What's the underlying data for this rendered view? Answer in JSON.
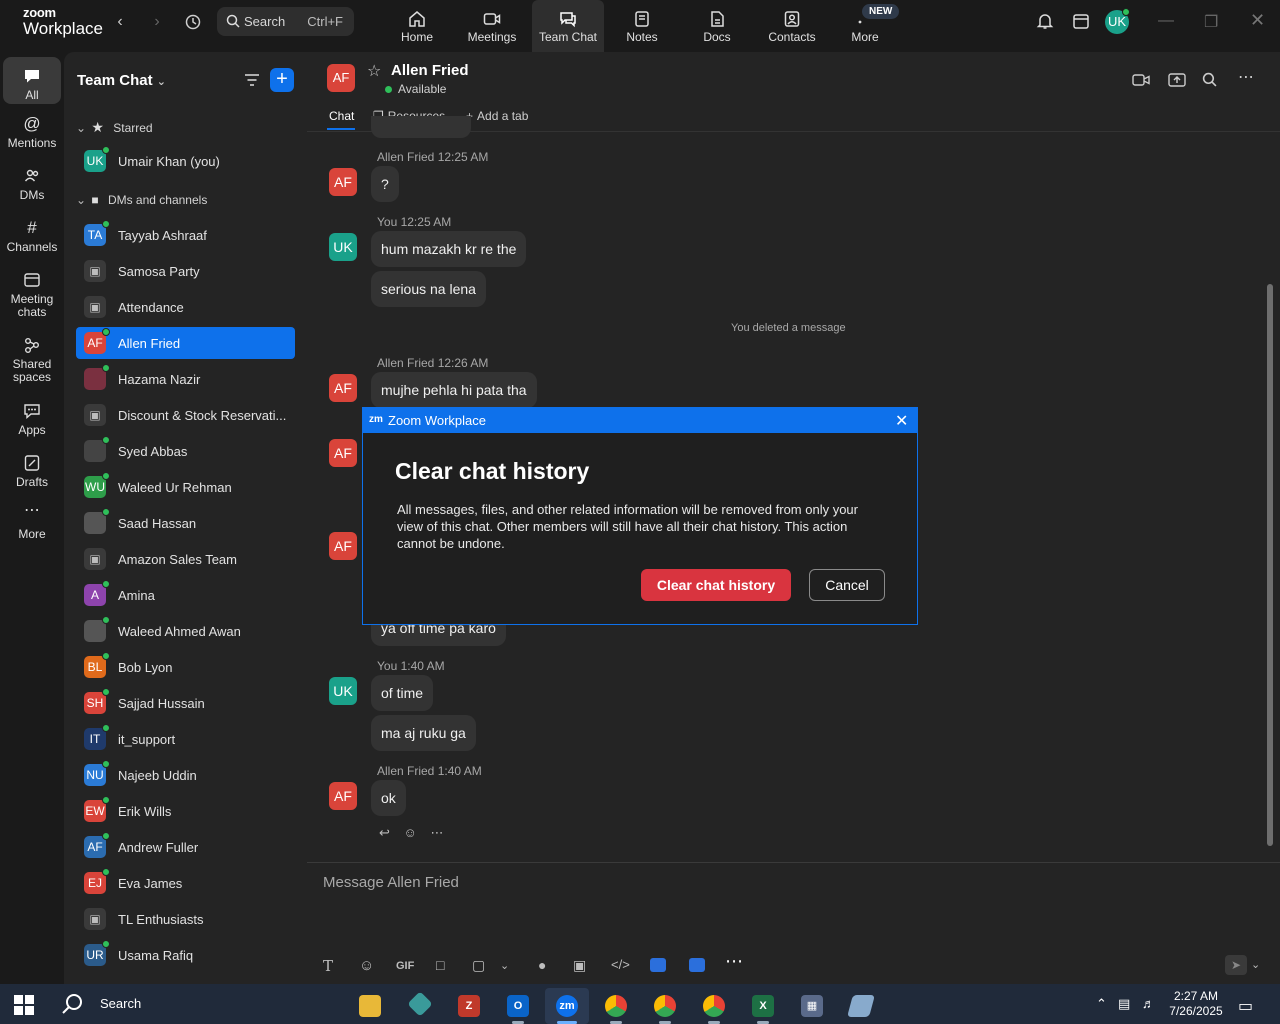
{
  "app": {
    "logo_line1": "zoom",
    "logo_line2": "Workplace"
  },
  "titlebar": {
    "search_placeholder": "Search",
    "search_shortcut": "Ctrl+F",
    "new_badge": "NEW",
    "avatar_initials": "UK",
    "nav": [
      {
        "label": "Home",
        "icon": "home-icon"
      },
      {
        "label": "Meetings",
        "icon": "video-icon"
      },
      {
        "label": "Team Chat",
        "icon": "chat-icon"
      },
      {
        "label": "Notes",
        "icon": "notes-icon"
      },
      {
        "label": "Docs",
        "icon": "docs-icon"
      },
      {
        "label": "Contacts",
        "icon": "contacts-icon"
      },
      {
        "label": "More",
        "icon": "more-icon"
      }
    ]
  },
  "rail": [
    {
      "label": "All"
    },
    {
      "label": "Mentions"
    },
    {
      "label": "DMs"
    },
    {
      "label": "Channels"
    },
    {
      "label": "Meeting chats"
    },
    {
      "label": "Shared spaces"
    },
    {
      "label": "Apps"
    },
    {
      "label": "Drafts"
    },
    {
      "label": "More"
    }
  ],
  "sidebar": {
    "title": "Team Chat",
    "section_starred": "Starred",
    "section_dms": "DMs and channels",
    "starred": [
      {
        "initials": "UK",
        "name": "Umair Khan (you)",
        "color": "#1aa18a"
      }
    ],
    "contacts": [
      {
        "initials": "TA",
        "name": "Tayyab Ashraaf",
        "color": "#2b7bd6"
      },
      {
        "initials": "",
        "name": "Samosa Party",
        "color": "#3a3a3a"
      },
      {
        "initials": "",
        "name": "Attendance",
        "color": "#3a3a3a"
      },
      {
        "initials": "AF",
        "name": "Allen Fried",
        "color": "#d9443a"
      },
      {
        "initials": "",
        "name": "Hazama Nazir",
        "color": "#7a3040"
      },
      {
        "initials": "",
        "name": "Discount & Stock Reservati...",
        "color": "#3a3a3a"
      },
      {
        "initials": "",
        "name": "Syed Abbas",
        "color": "#444"
      },
      {
        "initials": "WU",
        "name": "Waleed Ur Rehman",
        "color": "#2e9e4a"
      },
      {
        "initials": "",
        "name": "Saad Hassan",
        "color": "#555"
      },
      {
        "initials": "",
        "name": "Amazon Sales Team",
        "color": "#3a3a3a"
      },
      {
        "initials": "A",
        "name": "Amina",
        "color": "#8e44ad"
      },
      {
        "initials": "",
        "name": "Waleed Ahmed Awan",
        "color": "#555"
      },
      {
        "initials": "BL",
        "name": "Bob Lyon",
        "color": "#e06a1b"
      },
      {
        "initials": "SH",
        "name": "Sajjad Hussain",
        "color": "#d9443a"
      },
      {
        "initials": "IT",
        "name": "it_support",
        "color": "#1f3a6b"
      },
      {
        "initials": "NU",
        "name": "Najeeb Uddin",
        "color": "#2b7bd6"
      },
      {
        "initials": "EW",
        "name": "Erik Wills",
        "color": "#d9443a"
      },
      {
        "initials": "AF",
        "name": "Andrew Fuller",
        "color": "#2b6cb0"
      },
      {
        "initials": "EJ",
        "name": "Eva James",
        "color": "#d9443a"
      },
      {
        "initials": "",
        "name": "TL Enthusiasts",
        "color": "#3a3a3a"
      },
      {
        "initials": "UR",
        "name": "Usama Rafiq",
        "color": "#2b5b8a"
      }
    ]
  },
  "chat": {
    "avatar": "AF",
    "name": "Allen Fried",
    "status": "Available",
    "tabs": {
      "chat": "Chat",
      "resources": "Resources",
      "add": "Add a tab"
    },
    "messages": [
      {
        "who": "AF",
        "meta": "Allen Fried 12:25 AM",
        "text": "?"
      },
      {
        "who": "UK",
        "meta": "You 12:25 AM",
        "text": "hum mazakh kr re the"
      },
      {
        "who": "",
        "meta": "",
        "text": "serious na lena"
      },
      {
        "system": "You deleted a message"
      },
      {
        "who": "AF",
        "meta": "Allen Fried 12:26 AM",
        "text": "mujhe pehla hi pata tha"
      },
      {
        "who": "",
        "meta": "",
        "text": "ya off time pa karo"
      },
      {
        "who": "UK",
        "meta": "You 1:40 AM",
        "text": "of time"
      },
      {
        "who": "",
        "meta": "",
        "text": "ma aj ruku ga"
      },
      {
        "who": "AF",
        "meta": "Allen Fried 1:40 AM",
        "text": "ok"
      }
    ],
    "compose_placeholder": "Message Allen Fried",
    "gif_label": "GIF"
  },
  "modal": {
    "app_badge": "zm",
    "window_title": "Zoom Workplace",
    "heading": "Clear chat history",
    "body": "All messages, files, and other related information will be removed from only your view of this chat. Other members will still have all their chat history. This action cannot be undone.",
    "confirm": "Clear chat history",
    "cancel": "Cancel"
  },
  "taskbar": {
    "search": "Search",
    "time": "2:27 AM",
    "date": "7/26/2025",
    "zoom_badge": "zm"
  },
  "colors": {
    "accent": "#0e71eb",
    "danger": "#d9343f",
    "presence": "#2fbf5a"
  }
}
